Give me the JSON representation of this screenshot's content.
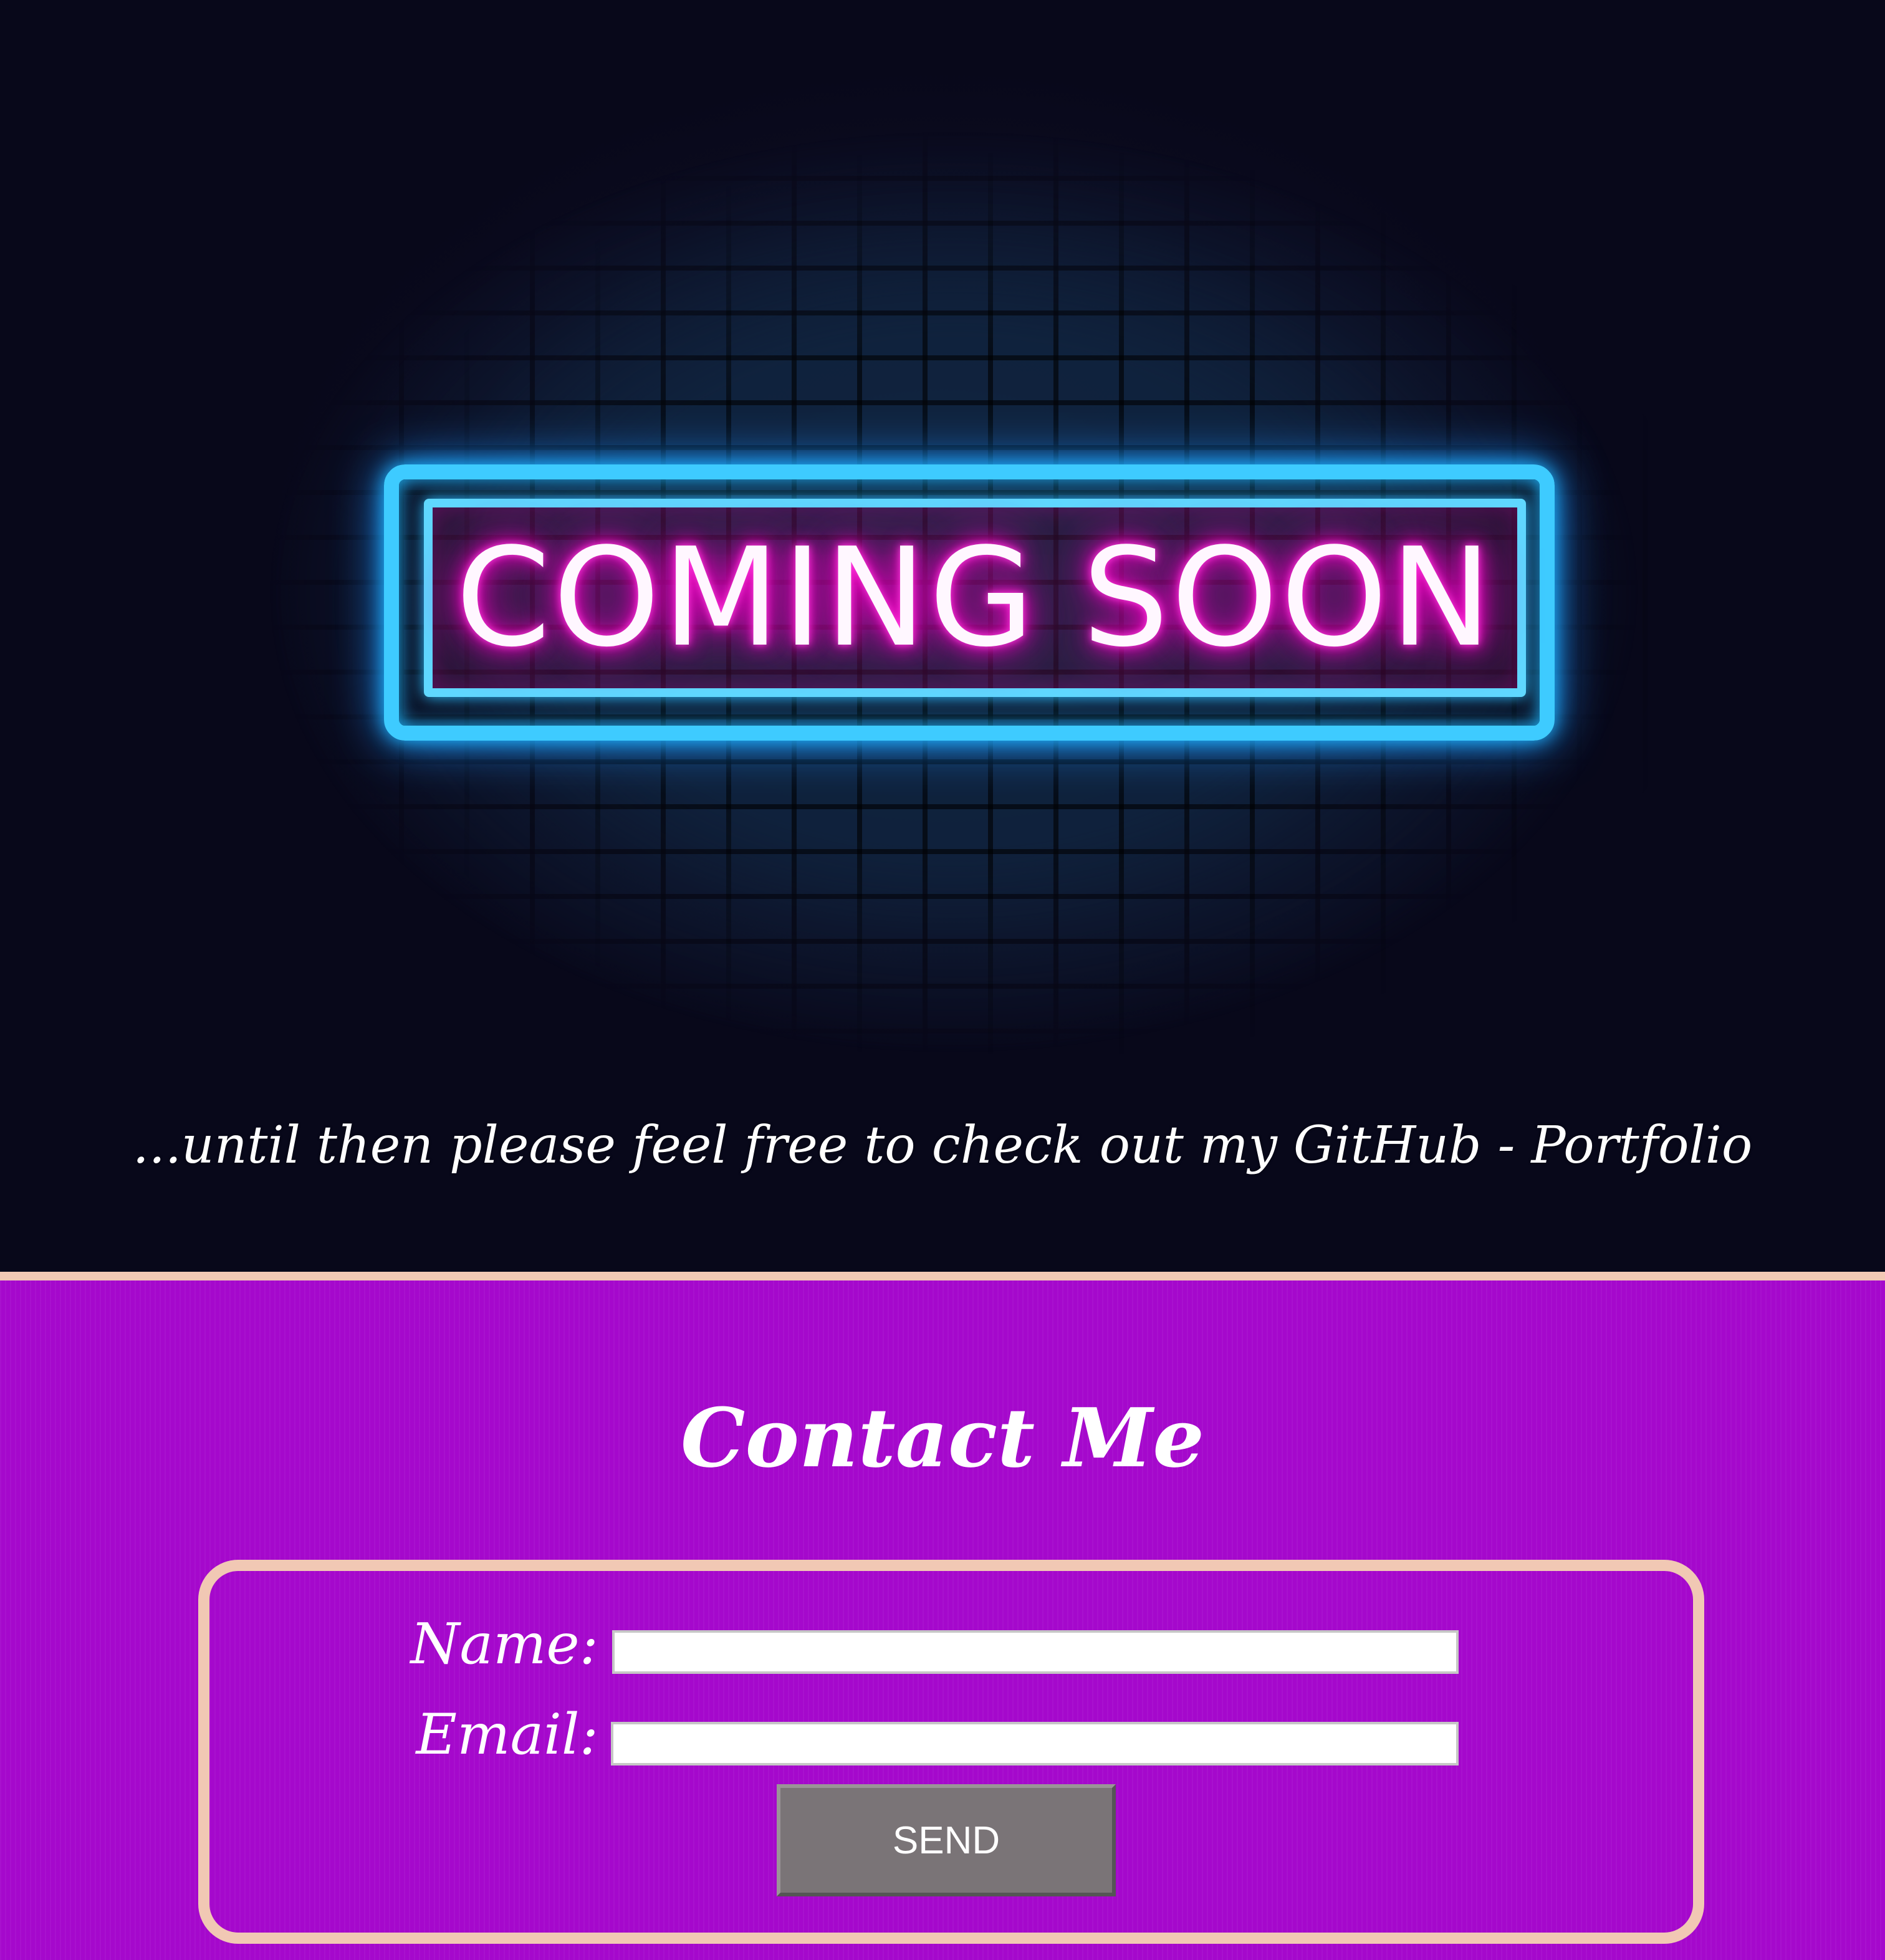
{
  "hero": {
    "sign_text": "COMING SOON",
    "tagline": "...until then please feel free to check out my GitHub - Portfolio"
  },
  "contact": {
    "title": "Contact Me",
    "name_label": "Name:",
    "email_label": "Email:",
    "name_value": "",
    "email_value": "",
    "send_label": "SEND"
  },
  "colors": {
    "background": "#0a0a1c",
    "neon_blue": "#3ecbff",
    "neon_pink": "#ff00c8",
    "contact_bg": "#a508cc",
    "border_peach": "#f2c9b5",
    "button_gray": "#7a7477"
  }
}
